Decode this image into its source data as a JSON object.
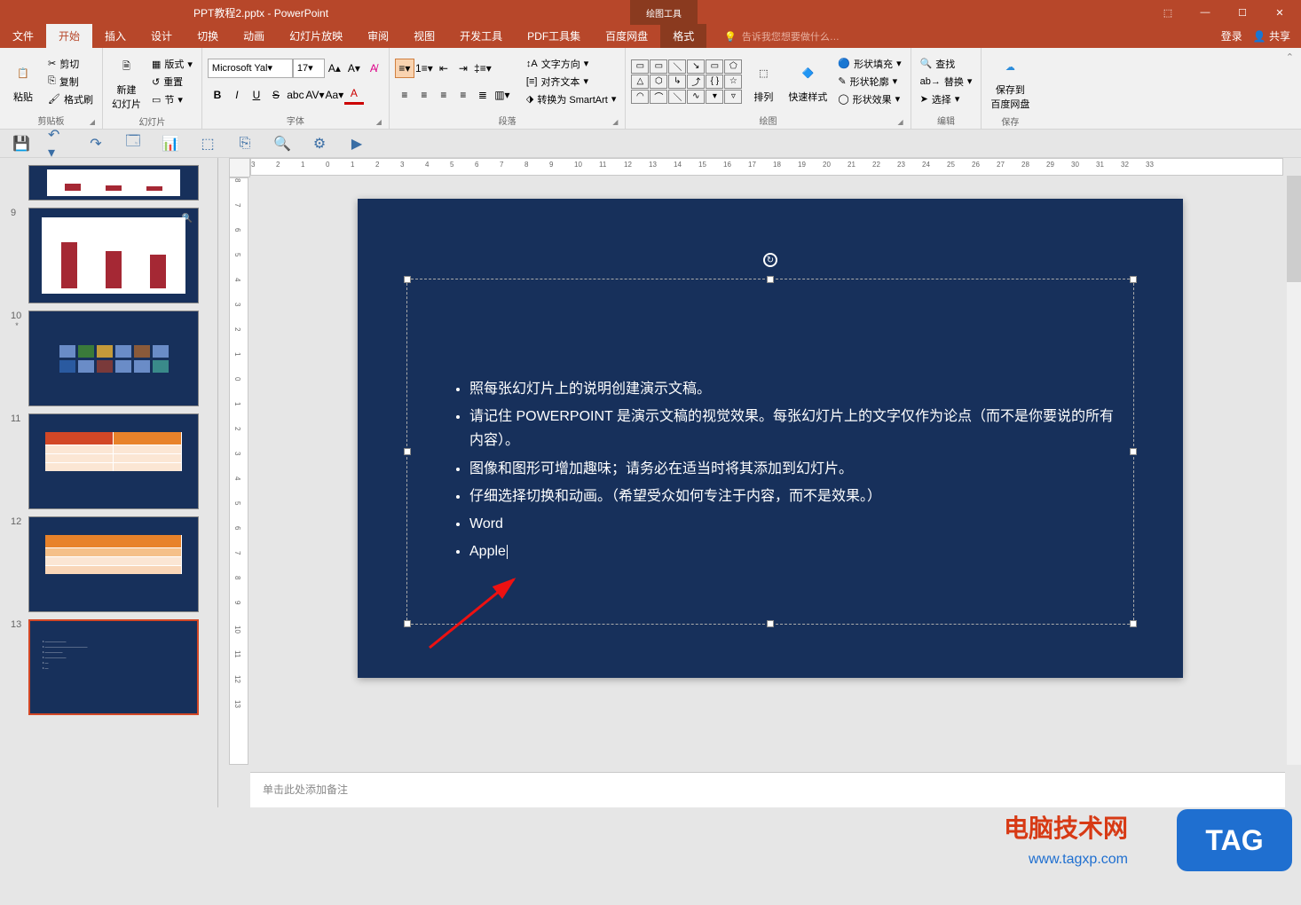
{
  "window": {
    "title": "PPT教程2.pptx - PowerPoint",
    "context_tool": "绘图工具",
    "context_tab": "格式"
  },
  "win_controls": {
    "ribbon_opts": "⬚",
    "min": "—",
    "max": "☐",
    "close": "✕"
  },
  "tabs": {
    "file": "文件",
    "home": "开始",
    "insert": "插入",
    "design": "设计",
    "transitions": "切换",
    "animations": "动画",
    "slideshow": "幻灯片放映",
    "review": "审阅",
    "view": "视图",
    "developer": "开发工具",
    "pdf": "PDF工具集",
    "baidu": "百度网盘",
    "format": "格式",
    "tell_me_icon": "💡",
    "tell_me": "告诉我您想要做什么…",
    "signin": "登录",
    "share": "共享"
  },
  "ribbon": {
    "clipboard": {
      "paste": "粘贴",
      "cut": "剪切",
      "copy": "复制",
      "painter": "格式刷",
      "label": "剪贴板"
    },
    "slides": {
      "new_slide": "新建\n幻灯片",
      "layout": "版式",
      "reset": "重置",
      "section": "节",
      "label": "幻灯片"
    },
    "font": {
      "name": "Microsoft Yal",
      "size": "17",
      "label": "字体"
    },
    "paragraph": {
      "textdir": "文字方向",
      "align": "对齐文本",
      "smartart": "转换为 SmartArt",
      "label": "段落"
    },
    "drawing": {
      "arrange": "排列",
      "quickstyle": "快速样式",
      "fill": "形状填充",
      "outline": "形状轮廓",
      "effects": "形状效果",
      "label": "绘图"
    },
    "editing": {
      "find": "查找",
      "replace": "替换",
      "select": "选择",
      "label": "编辑"
    },
    "baidu": {
      "save": "保存到\n百度网盘",
      "label": "保存"
    }
  },
  "thumbnails": {
    "items": [
      {
        "num": "",
        "type": "chart-top"
      },
      {
        "num": "9",
        "type": "chart"
      },
      {
        "num": "10",
        "type": "grid",
        "star": "*"
      },
      {
        "num": "11",
        "type": "table1"
      },
      {
        "num": "12",
        "type": "table2"
      },
      {
        "num": "13",
        "type": "text",
        "selected": true
      }
    ]
  },
  "slide": {
    "bullets": [
      "照每张幻灯片上的说明创建演示文稿。",
      "请记住 POWERPOINT 是演示文稿的视觉效果。每张幻灯片上的文字仅作为论点（而不是你要说的所有内容）。",
      "图像和图形可增加趣味；请务必在适当时将其添加到幻灯片。",
      "仔细选择切换和动画。（希望受众如何专注于内容，而不是效果。）",
      "Word",
      "Apple"
    ]
  },
  "notes": {
    "placeholder": "单击此处添加备注"
  },
  "ruler": {
    "h": [
      "3",
      "2",
      "1",
      "0",
      "1",
      "2",
      "3",
      "4",
      "5",
      "6",
      "7",
      "8",
      "9",
      "10",
      "11",
      "12",
      "13",
      "14",
      "15",
      "16",
      "17",
      "18",
      "19",
      "20",
      "21",
      "22",
      "23",
      "24",
      "25",
      "26",
      "27",
      "28",
      "29",
      "30",
      "31",
      "32",
      "33"
    ],
    "v": [
      "8",
      "7",
      "6",
      "5",
      "4",
      "3",
      "2",
      "1",
      "0",
      "1",
      "2",
      "3",
      "4",
      "5",
      "6",
      "7",
      "8",
      "9",
      "10",
      "11",
      "12",
      "13"
    ]
  },
  "watermark": {
    "site_cn": "电脑技术网",
    "site_url": "www.tagxp.com",
    "tag": "TAG"
  }
}
